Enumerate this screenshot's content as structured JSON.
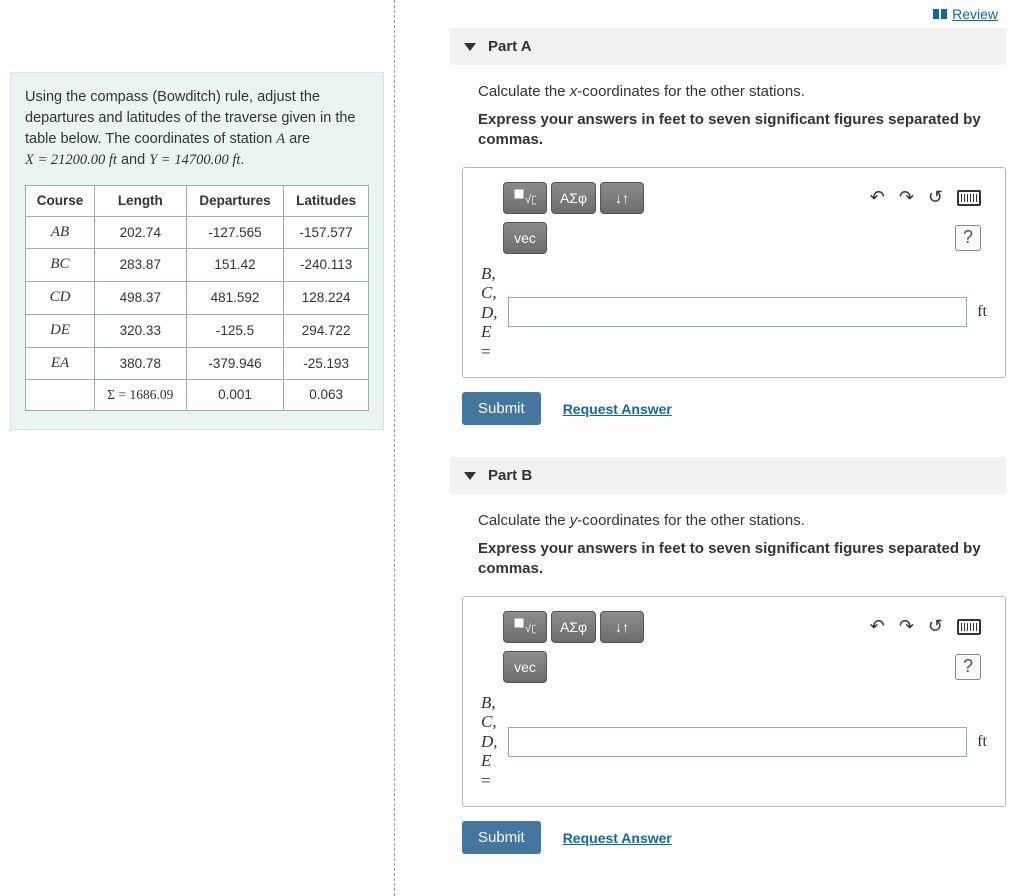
{
  "review_label": "Review",
  "left": {
    "intro_html": "Using the compass (Bowditch) rule, adjust the departures and latitudes of the traverse given in the table below. The coordinates of station A are X = 21200.00 ft and Y = 14700.00 ft.",
    "intro_plain1": "Using the compass (Bowditch) rule, adjust the departures and latitudes of the traverse given in the table below. The coordinates of station ",
    "intro_A": "A",
    "intro_plain2": " are",
    "intro_eqX": "X = 21200.00 ft",
    "intro_and": " and ",
    "intro_eqY": "Y = 14700.00 ft",
    "intro_period": ".",
    "table": {
      "headers": [
        "Course",
        "Length",
        "Departures",
        "Latitudes"
      ],
      "rows": [
        {
          "course": "AB",
          "length": "202.74",
          "dep": "-127.565",
          "lat": "-157.577"
        },
        {
          "course": "BC",
          "length": "283.87",
          "dep": "151.42",
          "lat": "-240.113"
        },
        {
          "course": "CD",
          "length": "498.37",
          "dep": "481.592",
          "lat": "128.224"
        },
        {
          "course": "DE",
          "length": "320.33",
          "dep": "-125.5",
          "lat": "294.722"
        },
        {
          "course": "EA",
          "length": "380.78",
          "dep": "-379.946",
          "lat": "-25.193"
        }
      ],
      "sum": {
        "label": "Σ = 1686.09",
        "dep": "0.001",
        "lat": "0.063"
      }
    }
  },
  "partA": {
    "title": "Part A",
    "prompt_pre": "Calculate the ",
    "prompt_var": "x",
    "prompt_post": "-coordinates for the other stations.",
    "express": "Express your answers in feet to seven significant figures separated by commas.",
    "vec": "vec",
    "greek": "ΑΣφ",
    "varlabels": "B,\nC,\nD,\nE\n=",
    "unit": "ft",
    "submit": "Submit",
    "request": "Request Answer"
  },
  "partB": {
    "title": "Part B",
    "prompt_pre": "Calculate the ",
    "prompt_var": "y",
    "prompt_post": "-coordinates for the other stations.",
    "express": "Express your answers in feet to seven significant figures separated by commas.",
    "vec": "vec",
    "greek": "ΑΣφ",
    "varlabels": "B,\nC,\nD,\nE\n=",
    "unit": "ft",
    "submit": "Submit",
    "request": "Request Answer"
  }
}
